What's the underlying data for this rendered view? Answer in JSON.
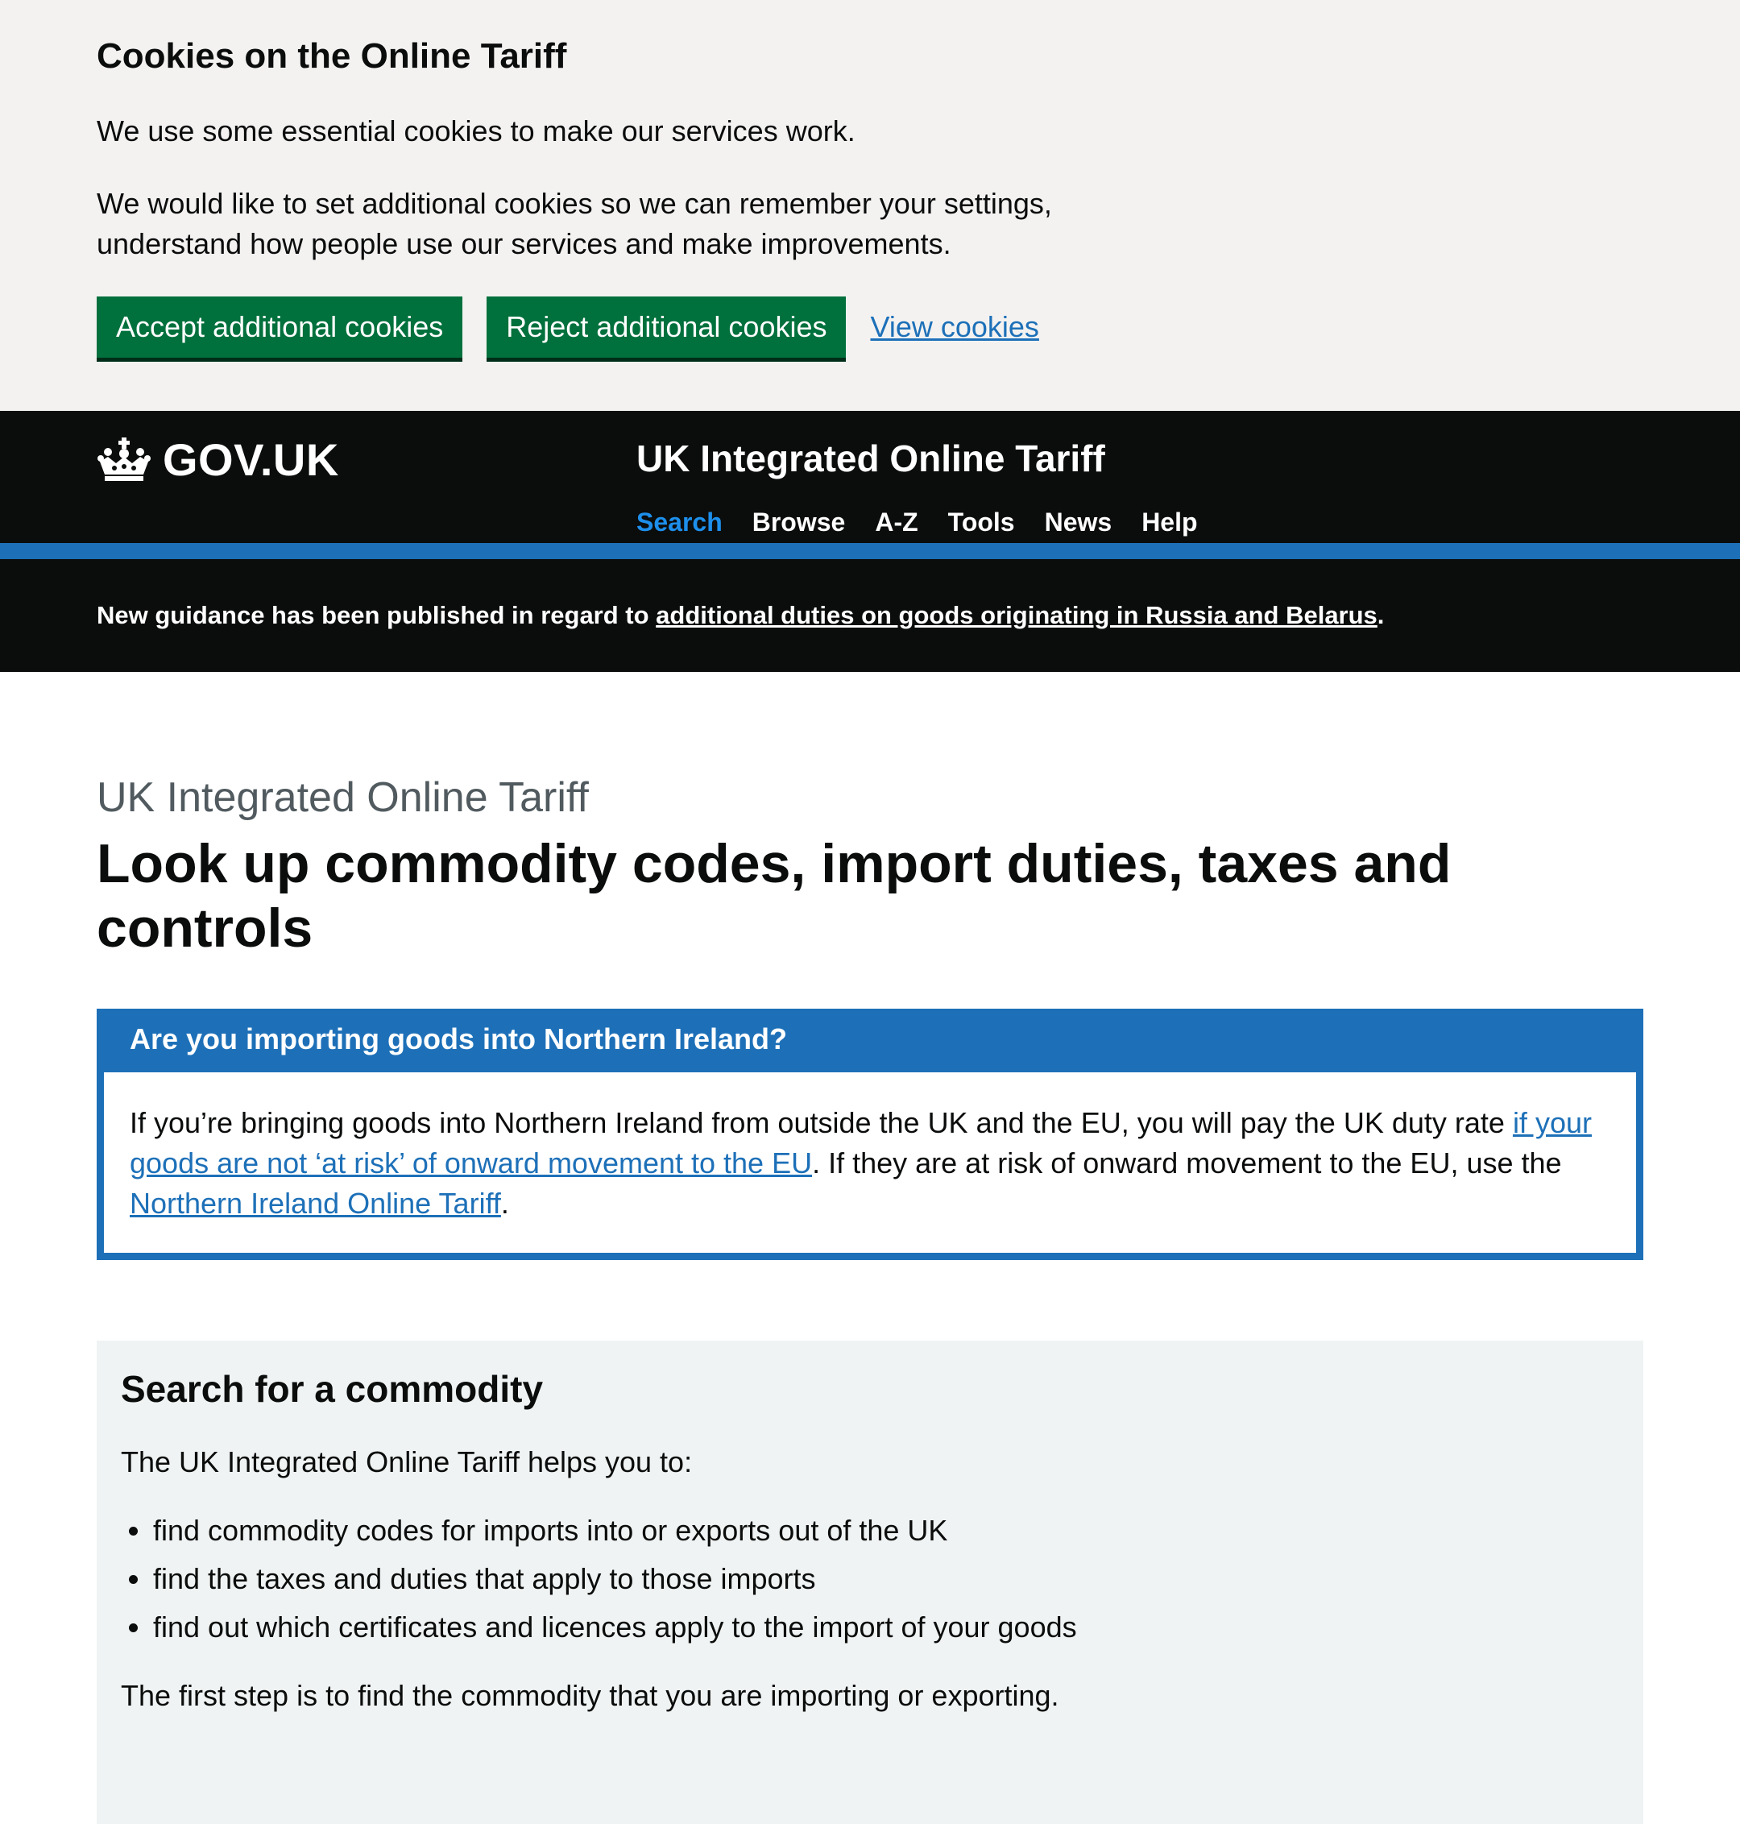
{
  "cookie_banner": {
    "heading": "Cookies on the Online Tariff",
    "para1": "We use some essential cookies to make our services work.",
    "para2": "We would like to set additional cookies so we can remember your settings, understand how people use our services and make improvements.",
    "accept_label": "Accept additional cookies",
    "reject_label": "Reject additional cookies",
    "view_label": "View cookies"
  },
  "header": {
    "logo_text": "GOV.UK",
    "service_name": "UK Integrated Online Tariff",
    "nav": [
      "Search",
      "Browse",
      "A-Z",
      "Tools",
      "News",
      "Help"
    ],
    "active_nav": "Search"
  },
  "notice": {
    "text_before": "New guidance has been published in regard to ",
    "link_text": "additional duties on goods originating in Russia and Belarus",
    "text_after": "."
  },
  "main": {
    "caption": "UK Integrated Online Tariff",
    "title": "Look up commodity codes, import duties, taxes and controls",
    "ni_box": {
      "heading": "Are you importing goods into Northern Ireland?",
      "text1": "If you’re bringing goods into Northern Ireland from outside the UK and the EU, you will pay the UK duty rate ",
      "link1": "if your goods are not ‘at risk’ of onward movement to the EU",
      "text2": ". If they are at risk of onward movement to the EU, use the ",
      "link2": "Northern Ireland Online Tariff",
      "text3": "."
    },
    "search_panel": {
      "heading": "Search for a commodity",
      "intro": "The UK Integrated Online Tariff helps you to:",
      "items": [
        "find commodity codes for imports into or exports out of the UK",
        "find the taxes and duties that apply to those imports",
        "find out which certificates and licences apply to the import of your goods"
      ],
      "step": "The first step is to find the commodity that you are importing or exporting."
    }
  },
  "colors": {
    "govuk_black": "#0b0c0c",
    "brand_blue": "#1d70b8",
    "button_green": "#00703c",
    "banner_grey": "#f3f2f1",
    "panel_grey": "#f0f3f3"
  }
}
